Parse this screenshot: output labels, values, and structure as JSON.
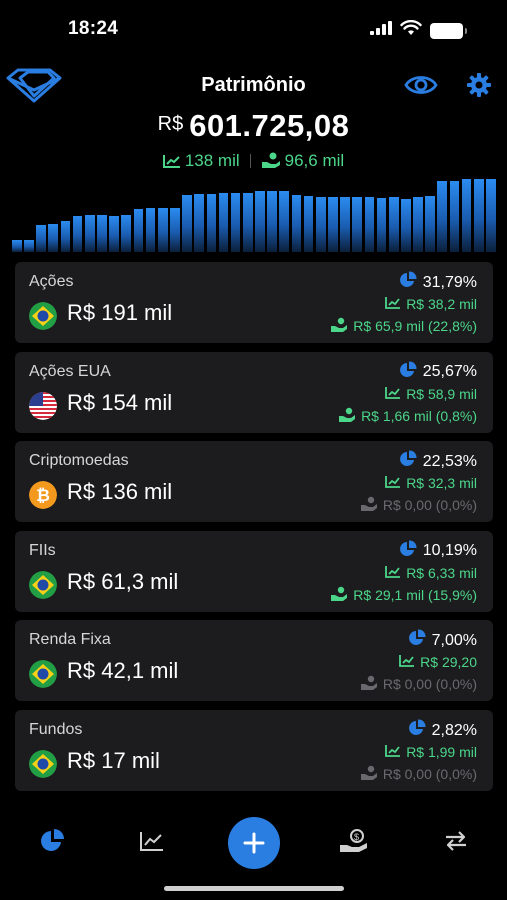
{
  "status": {
    "time": "18:24"
  },
  "header": {
    "title": "Patrimônio",
    "currency": "R$",
    "total": "601.725,08",
    "gain": "138 mil",
    "dividends": "96,6 mil"
  },
  "history_bars": [
    0.15,
    0.16,
    0.34,
    0.36,
    0.4,
    0.46,
    0.48,
    0.47,
    0.46,
    0.48,
    0.55,
    0.56,
    0.56,
    0.57,
    0.73,
    0.75,
    0.74,
    0.76,
    0.76,
    0.76,
    0.78,
    0.78,
    0.78,
    0.73,
    0.72,
    0.71,
    0.71,
    0.71,
    0.71,
    0.7,
    0.69,
    0.7,
    0.68,
    0.7,
    0.72,
    0.91,
    0.91,
    0.93,
    0.93,
    0.93
  ],
  "categories": [
    {
      "name": "Ações",
      "flag": "br",
      "value": "R$ 191 mil",
      "pct": "31,79%",
      "gain": "R$ 38,2 mil",
      "div": "R$ 65,9 mil (22,8%)",
      "div_zero": false
    },
    {
      "name": "Ações EUA",
      "flag": "us",
      "value": "R$ 154 mil",
      "pct": "25,67%",
      "gain": "R$ 58,9 mil",
      "div": "R$ 1,66 mil (0,8%)",
      "div_zero": false
    },
    {
      "name": "Criptomoedas",
      "flag": "btc",
      "value": "R$ 136 mil",
      "pct": "22,53%",
      "gain": "R$ 32,3 mil",
      "div": "R$ 0,00 (0,0%)",
      "div_zero": true
    },
    {
      "name": "FIIs",
      "flag": "br",
      "value": "R$ 61,3 mil",
      "pct": "10,19%",
      "gain": "R$ 6,33 mil",
      "div": "R$ 29,1 mil (15,9%)",
      "div_zero": false
    },
    {
      "name": "Renda Fixa",
      "flag": "br",
      "value": "R$ 42,1 mil",
      "pct": "7,00%",
      "gain": "R$ 29,20",
      "div": "R$ 0,00 (0,0%)",
      "div_zero": true
    },
    {
      "name": "Fundos",
      "flag": "br",
      "value": "R$ 17 mil",
      "pct": "2,82%",
      "gain": "R$ 1,99 mil",
      "div": "R$ 0,00 (0,0%)",
      "div_zero": true
    }
  ],
  "tabs": [
    {
      "icon": "pie-chart-icon",
      "active": true
    },
    {
      "icon": "line-chart-icon",
      "active": false
    },
    {
      "icon": "plus-icon",
      "active": false
    },
    {
      "icon": "dividend-hand-icon",
      "active": false
    },
    {
      "icon": "transfer-arrows-icon",
      "active": false
    }
  ],
  "colors": {
    "accent": "#2a7de1",
    "gain": "#4cd68a",
    "card": "#1c1c1e",
    "muted": "#6a6a6e"
  }
}
